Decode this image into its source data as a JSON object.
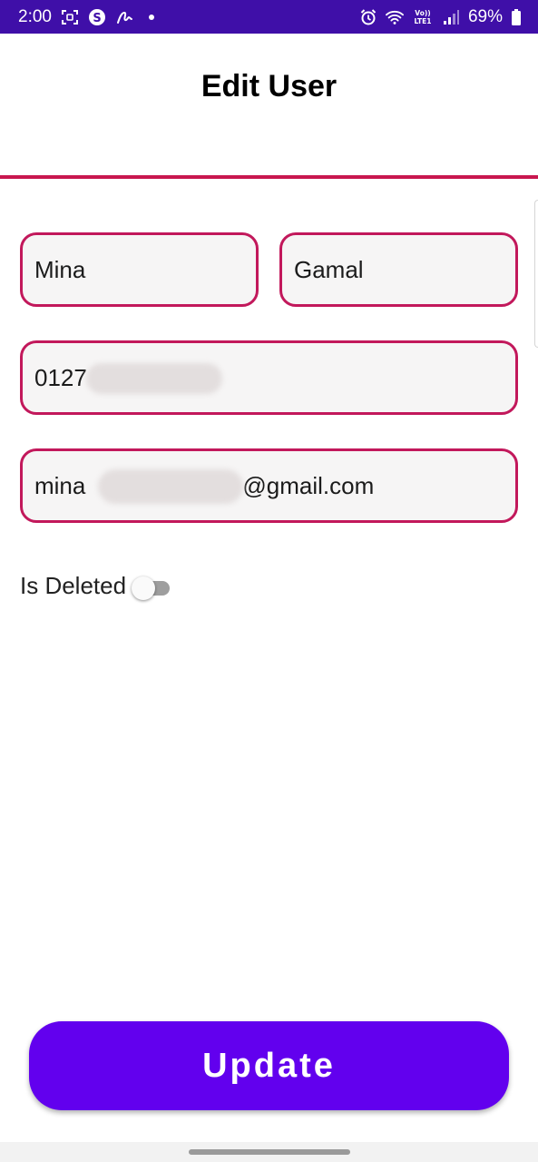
{
  "status_bar": {
    "time": "2:00",
    "battery": "69%",
    "left_icons": [
      "screenshot-icon",
      "skype-icon",
      "signature-icon",
      "notification-dot-icon"
    ],
    "right_icons": [
      "alarm-icon",
      "wifi-icon",
      "volte-icon",
      "signal-icon",
      "battery-icon"
    ]
  },
  "header": {
    "title": "Edit User"
  },
  "form": {
    "first_name": "Mina",
    "last_name": "Gamal",
    "phone": "0127",
    "email_prefix": "mina",
    "email_suffix": "@gmail.com",
    "is_deleted_label": "Is Deleted",
    "is_deleted": false
  },
  "actions": {
    "update_label": "Update"
  },
  "colors": {
    "status_bar": "#3f0fa8",
    "accent": "#c8174f",
    "button": "#6200ee"
  }
}
